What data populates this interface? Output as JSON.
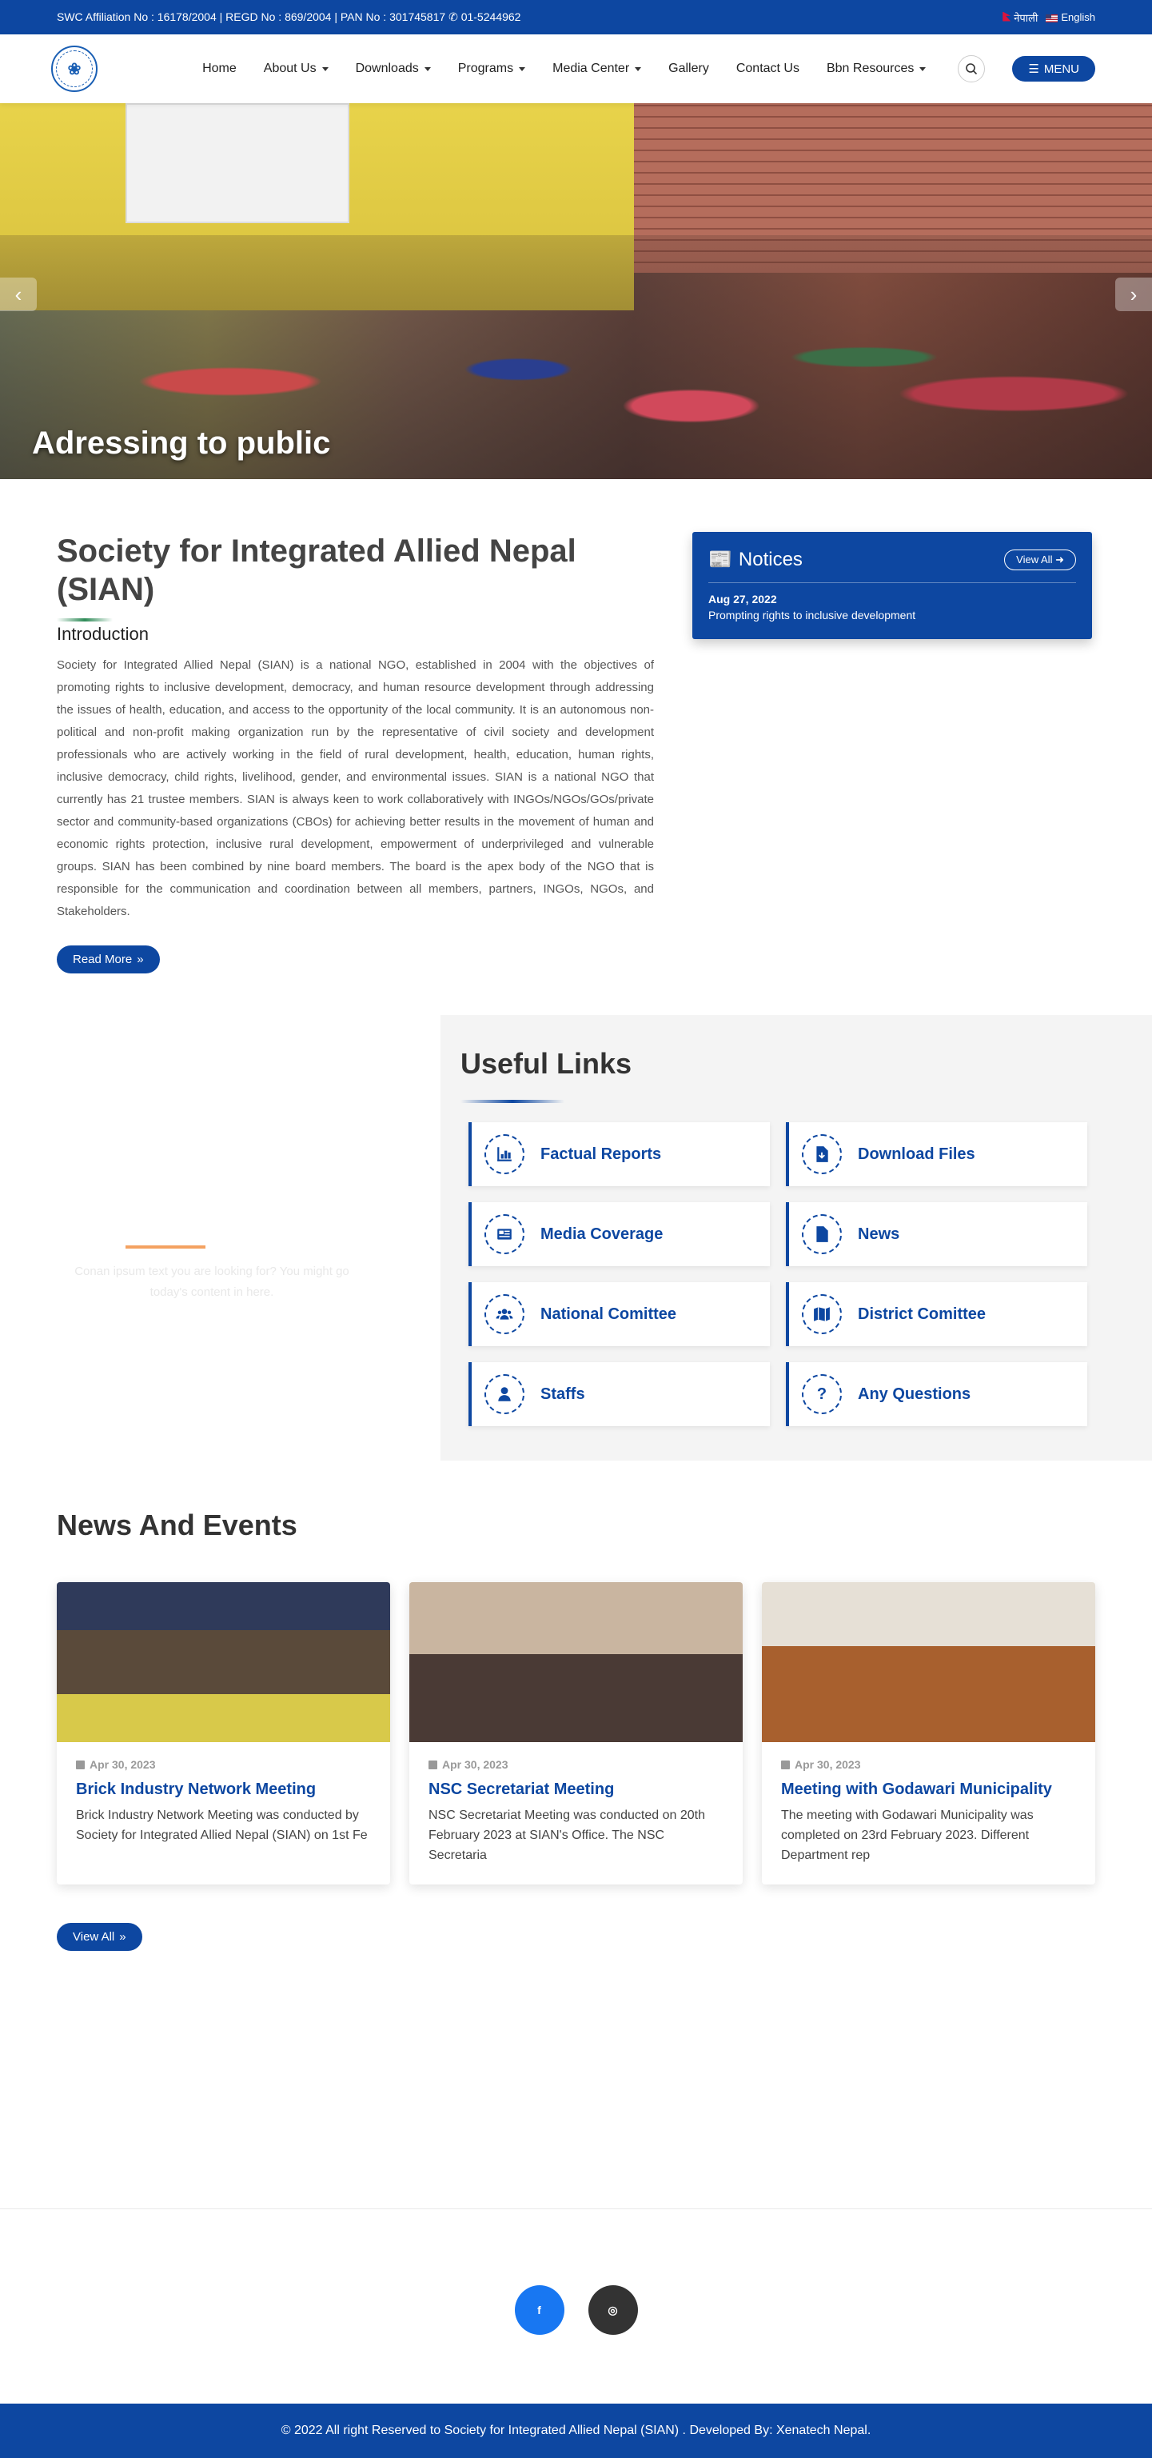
{
  "topbar": {
    "info": "SWC Affiliation No :  16178/2004 | REGD No :  869/2004 | PAN No :  301745817",
    "phone": "01-5244962",
    "lang_nepali": "नेपाली",
    "lang_english": "English"
  },
  "nav": {
    "items": [
      {
        "label": "Home",
        "dropdown": false
      },
      {
        "label": "About Us",
        "dropdown": true
      },
      {
        "label": "Downloads",
        "dropdown": true
      },
      {
        "label": "Programs",
        "dropdown": true
      },
      {
        "label": "Media Center",
        "dropdown": true
      },
      {
        "label": "Gallery",
        "dropdown": false
      },
      {
        "label": "Contact Us",
        "dropdown": false
      },
      {
        "label": "Bbn Resources",
        "dropdown": true
      }
    ],
    "menu_label": "MENU"
  },
  "hero": {
    "caption": "Adressing to public"
  },
  "intro": {
    "title": "Society for Integrated Allied Nepal (SIAN)",
    "subtitle": "Introduction",
    "body": "Society for Integrated Allied Nepal (SIAN) is a national NGO, established in 2004 with the objectives of promoting rights to inclusive development, democracy, and human resource development through addressing the issues of health, education, and access to the opportunity of the local community. It is an autonomous non-political and non-profit making organization run by the representative of civil society and development professionals who are actively working in the field of rural development, health, education, human rights, inclusive democracy, child rights, livelihood, gender, and environmental issues. SIAN is a national NGO that currently has 21 trustee members. SIAN is always keen to work collaboratively with INGOs/NGOs/GOs/private sector and community-based organizations (CBOs) for achieving better results in the movement of human and economic rights protection, inclusive rural development, empowerment of underprivileged and vulnerable groups. SIAN has been combined by nine board members. The board is the apex body of the NGO that is responsible for the communication and coordination between all members, partners, INGOs, NGOs, and Stakeholders.",
    "read_more": "Read More"
  },
  "notices": {
    "title": "Notices",
    "view_all": "View All",
    "items": [
      {
        "date": "Aug 27, 2022",
        "text": "Prompting rights to inclusive development"
      }
    ]
  },
  "placeholder_text": "Conan ipsum text you are looking for? You might go today's content in here.",
  "useful_links": {
    "title": "Useful Links",
    "items": [
      {
        "label": "Factual Reports",
        "icon": "chart-icon"
      },
      {
        "label": "Download Files",
        "icon": "file-download-icon"
      },
      {
        "label": "Media Coverage",
        "icon": "newspaper-icon"
      },
      {
        "label": "News",
        "icon": "file-icon"
      },
      {
        "label": "National Comittee",
        "icon": "users-icon"
      },
      {
        "label": "District Comittee",
        "icon": "map-icon"
      },
      {
        "label": "Staffs",
        "icon": "user-icon"
      },
      {
        "label": "Any Questions",
        "icon": "question-icon"
      }
    ]
  },
  "news": {
    "title": "News And Events",
    "items": [
      {
        "date": "Apr 30, 2023",
        "title": "Brick Industry Network Meeting",
        "excerpt": "Brick Industry Network Meeting was conducted by Society for Integrated Allied Nepal (SIAN) on 1st Fe"
      },
      {
        "date": "Apr 30, 2023",
        "title": "NSC Secretariat Meeting",
        "excerpt": "NSC Secretariat Meeting was conducted on 20th February 2023 at SIAN's Office. The NSC Secretaria"
      },
      {
        "date": "Apr 30, 2023",
        "title": "Meeting with Godawari Municipality",
        "excerpt": "The meeting with Godawari Municipality was completed on 23rd February 2023. Different Department rep"
      }
    ],
    "view_all": "View All"
  },
  "social": {
    "facebook": "facebook-icon",
    "instagram": "instagram-icon"
  },
  "footer": {
    "text": "© 2022 All right Reserved to Society for Integrated Allied Nepal (SIAN) . Developed By: Xenatech Nepal."
  },
  "colors": {
    "primary": "#0d47a1",
    "accent_green": "#2e8b57",
    "accent_orange": "#f4a261",
    "facebook": "#1877f2"
  }
}
